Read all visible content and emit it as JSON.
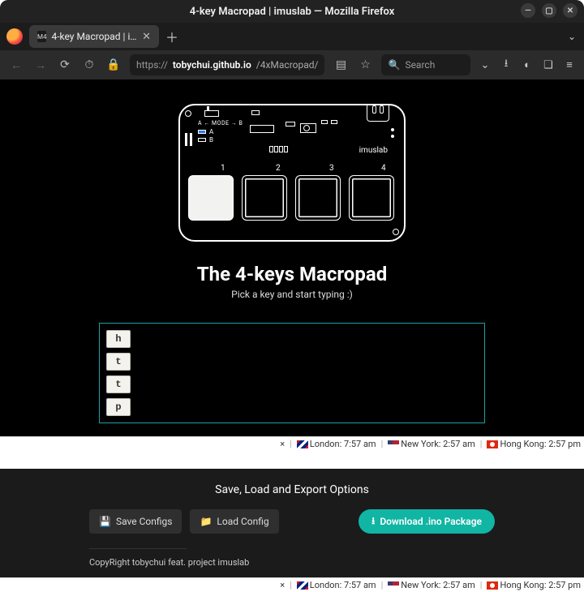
{
  "window": {
    "title": "4-key Macropad | imuslab — Mozilla Firefox"
  },
  "tab": {
    "label": "4-key Macropad | imuslab",
    "favicon_text": "M4"
  },
  "nav": {
    "scheme": "https://",
    "host": "tobychui.github.io",
    "path": "/4xMacropad/",
    "search_placeholder": "Search"
  },
  "pcb": {
    "mode_label": "A ← MODE → B",
    "led_a": "A",
    "led_b": "B",
    "brand": "imuslab",
    "key_labels": [
      "1",
      "2",
      "3",
      "4"
    ]
  },
  "content": {
    "heading": "The 4-keys Macropad",
    "sub": "Pick a key and start typing :)",
    "chips": [
      "h",
      "t",
      "t",
      "p"
    ]
  },
  "status": {
    "close": "×",
    "clocks": [
      {
        "flag": "uk",
        "text": "London: 7:57 am"
      },
      {
        "flag": "us",
        "text": "New York: 2:57 am"
      },
      {
        "flag": "hk",
        "text": "Hong Kong: 2:57 pm"
      }
    ]
  },
  "panel2": {
    "title": "Save, Load and Export Options",
    "save": "Save Configs",
    "load": "Load Config",
    "download": "Download .ino Package",
    "copyright": "CopyRight tobychui feat. project imuslab"
  }
}
